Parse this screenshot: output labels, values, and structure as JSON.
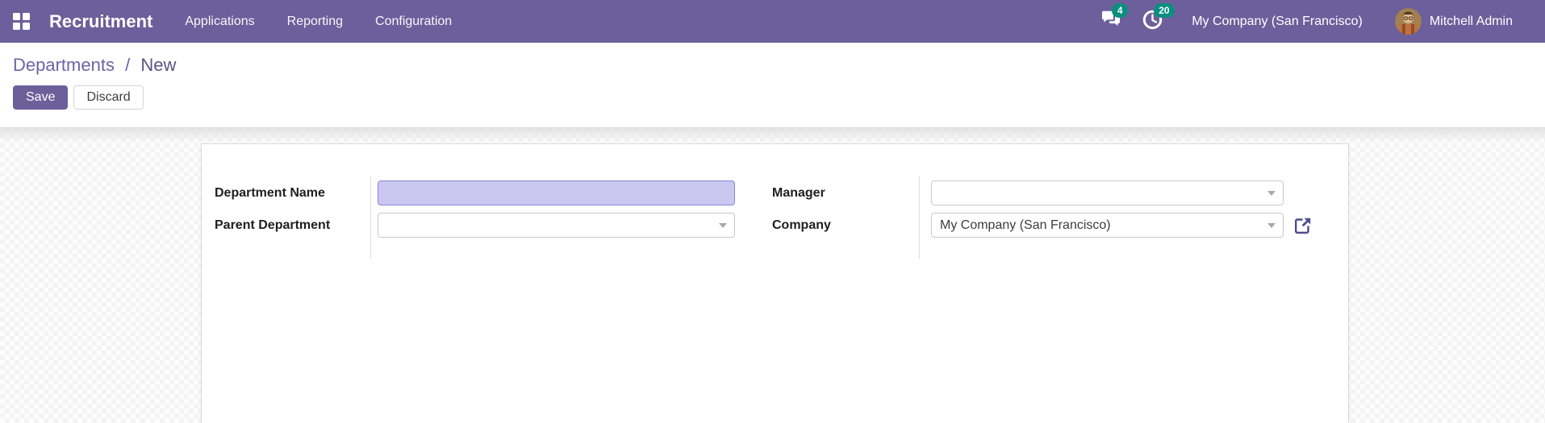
{
  "navbar": {
    "brand": "Recruitment",
    "menus": [
      {
        "label": "Applications"
      },
      {
        "label": "Reporting"
      },
      {
        "label": "Configuration"
      }
    ],
    "systray": {
      "messages_badge": "4",
      "activities_badge": "20",
      "company": "My Company (San Francisco)",
      "user": "Mitchell Admin"
    }
  },
  "breadcrumb": {
    "parent": "Departments",
    "separator": "/",
    "current": "New"
  },
  "buttons": {
    "save": "Save",
    "discard": "Discard"
  },
  "form": {
    "department_name": {
      "label": "Department Name",
      "value": ""
    },
    "parent_department": {
      "label": "Parent Department",
      "value": ""
    },
    "manager": {
      "label": "Manager",
      "value": ""
    },
    "company": {
      "label": "Company",
      "value": "My Company (San Francisco)"
    }
  },
  "colors": {
    "navbar_bg": "#6c5f9b",
    "badge_bg": "#0b8e80",
    "primary_button_bg": "#6d5f9a",
    "breadcrumb_link": "#6e63a5",
    "highlight_field_bg": "#cac8f0",
    "highlight_field_border": "#8b85d6",
    "external_link_icon": "#4f4a8f"
  }
}
